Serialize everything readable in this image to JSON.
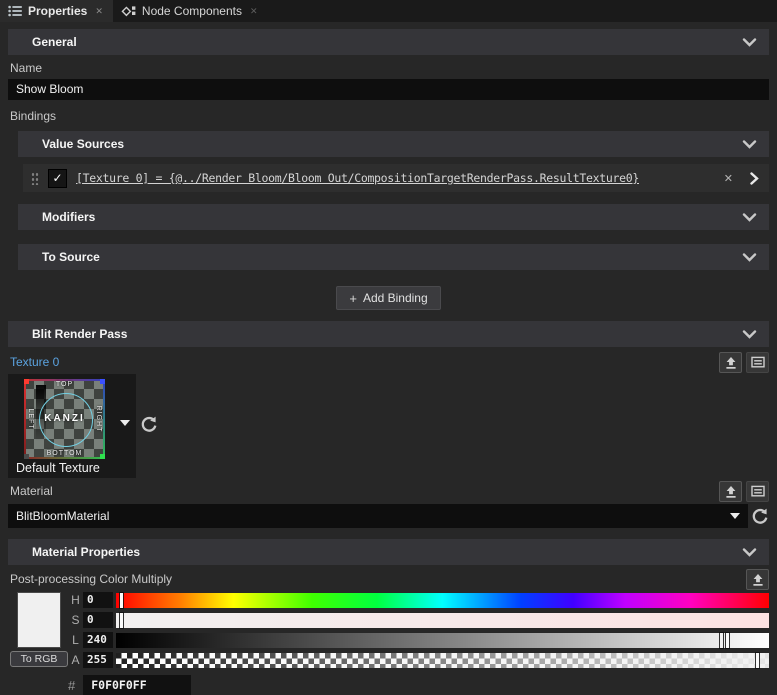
{
  "tabs": [
    {
      "label": "Properties",
      "active": true
    },
    {
      "label": "Node Components",
      "active": false
    }
  ],
  "sections": {
    "general": "General",
    "value_sources": "Value Sources",
    "modifiers": "Modifiers",
    "to_source": "To Source",
    "blit_render_pass": "Blit Render Pass",
    "material_properties": "Material Properties"
  },
  "fields": {
    "name": {
      "label": "Name",
      "value": "Show Bloom"
    },
    "bindings_label": "Bindings",
    "binding": {
      "checked": true,
      "check_glyph": "✓",
      "expression": "[Texture 0] = {@../Render Bloom/Bloom Out/CompositionTargetRenderPass.ResultTexture0}",
      "remove_glyph": "✕"
    },
    "add_binding": {
      "plus": "+",
      "label": "Add Binding"
    },
    "texture": {
      "label": "Texture 0",
      "value": "Default Texture",
      "thumb": {
        "top": "TOP",
        "bottom": "BOTTOM",
        "left": "LEFT",
        "right": "RIGHT",
        "center": "KANZI"
      }
    },
    "material": {
      "label": "Material",
      "value": "BlitBloomMaterial"
    },
    "color": {
      "label": "Post-processing Color Multiply",
      "to_rgb_label": "To RGB",
      "channels": [
        {
          "key": "H",
          "value": "0",
          "slider_pct": 0.8
        },
        {
          "key": "S",
          "value": "0",
          "slider_pct": 0.8
        },
        {
          "key": "L",
          "value": "240",
          "slider_pct": 93.5
        },
        {
          "key": "A",
          "value": "255",
          "slider_pct": 98.2
        }
      ],
      "hex_label": "#",
      "hex": "F0F0F0FF",
      "swatch": "#F0F0F0"
    }
  },
  "colors": {
    "panel_bg": "#272727",
    "tabbar_bg": "#1A1A1A",
    "section_header_bg": "#353539",
    "input_bg": "#0E0E0E",
    "accent_blue": "#5BA3E0",
    "swatch": "#F0F0F0"
  }
}
